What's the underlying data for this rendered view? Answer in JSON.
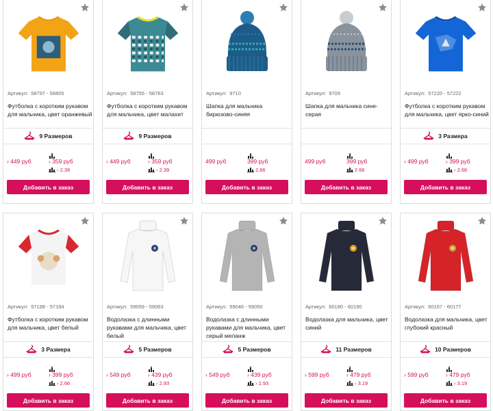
{
  "colors": {
    "accent": "#d60f5d",
    "price": "#d1105b",
    "border": "#dcdcdc",
    "star": "#8c8c8c"
  },
  "products": [
    {
      "article_label": "Артикул:",
      "article": "58797 - 58805",
      "title": "Футболка с коротким рукавом для мальчика, цвет оранжевый",
      "sizes": "9 Размеров",
      "price_left": "› 449 руб",
      "price_right": "› 359 руб",
      "rating": "› 2.39",
      "button": "Добавить в заказ",
      "icon": "tshirt-orange-icon"
    },
    {
      "article_label": "Артикул:",
      "article": "58755 - 58763",
      "title": "Футболка с коротким рукавом для мальчика, цвет малахит",
      "sizes": "9 Размеров",
      "price_left": "› 449 руб",
      "price_right": "› 359 руб",
      "rating": "› 2.39",
      "button": "Добавить в заказ",
      "icon": "tshirt-malachite-icon"
    },
    {
      "article_label": "Артикул:",
      "article": "9710",
      "title": "Шапка для мальчика бирюзово-синяя",
      "sizes": "",
      "price_left": "499 руб",
      "price_right": "399 руб",
      "rating": "2.66",
      "button": "Добавить в заказ",
      "icon": "hat-turquoise-icon"
    },
    {
      "article_label": "Артикул:",
      "article": "9709",
      "title": "Шапка для мальчика сине-серая",
      "sizes": "",
      "price_left": "499 руб",
      "price_right": "399 руб",
      "rating": "2.66",
      "button": "Добавить в заказ",
      "icon": "hat-gray-icon"
    },
    {
      "article_label": "Артикул:",
      "article": "57220 - 57222",
      "title": "Футболка с коротким рукавом для мальчика, цвет ярко-синий",
      "sizes": "3 Размера",
      "price_left": "› 499 руб",
      "price_right": "› 399 руб",
      "rating": "› 2.66",
      "button": "Добавить в заказ",
      "icon": "tshirt-blue-icon"
    },
    {
      "article_label": "Артикул:",
      "article": "57188 - 57194",
      "title": "Футболка с коротким рукавом для мальчика, цвет белый",
      "sizes": "3 Размера",
      "price_left": "› 499 руб",
      "price_right": "› 399 руб",
      "rating": "› 2.66",
      "button": "Добавить в заказ",
      "icon": "tshirt-white-icon"
    },
    {
      "article_label": "Артикул:",
      "article": "59059 - 59063",
      "title": "Водолазка с длинными рукавами для мальчика, цвет белый",
      "sizes": "5 Размеров",
      "price_left": "› 549 руб",
      "price_right": "› 439 руб",
      "rating": "› 2.93",
      "button": "Добавить в заказ",
      "icon": "turtleneck-white-icon"
    },
    {
      "article_label": "Артикул:",
      "article": "59046 - 59050",
      "title": "Водолазка с длинными рукавами для мальчика, цвет серый меланж",
      "sizes": "5 Размеров",
      "price_left": "› 549 руб",
      "price_right": "› 439 руб",
      "rating": "› 2.93",
      "button": "Добавить в заказ",
      "icon": "turtleneck-gray-icon"
    },
    {
      "article_label": "Артикул:",
      "article": "60180 - 60190",
      "title": "Водолазка для мальчика, цвет синий",
      "sizes": "11 Размеров",
      "price_left": "› 599 руб",
      "price_right": "› 479 руб",
      "rating": "› 3.19",
      "button": "Добавить в заказ",
      "icon": "turtleneck-navy-icon"
    },
    {
      "article_label": "Артикул:",
      "article": "60167 - 60177",
      "title": "Водолазка для мальчика, цвет глубокий красный",
      "sizes": "10 Размеров",
      "price_left": "› 599 руб",
      "price_right": "› 479 руб",
      "rating": "› 3.19",
      "button": "Добавить в заказ",
      "icon": "turtleneck-red-icon"
    }
  ]
}
